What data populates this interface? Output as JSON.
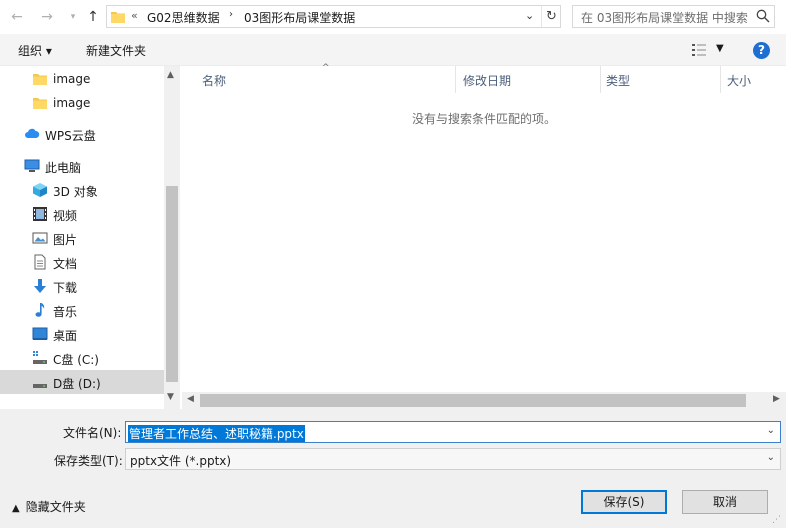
{
  "address": {
    "overflow": "«",
    "crumbs": [
      "G02思维数据",
      "03图形布局课堂数据"
    ],
    "separator": "›"
  },
  "search": {
    "placeholder": "在 03图形布局课堂数据 中搜索"
  },
  "toolbar": {
    "organize": "组织 ▾",
    "new_folder": "新建文件夹",
    "help": "?"
  },
  "nav": {
    "items": [
      {
        "label": "image",
        "icon": "folder-icon"
      },
      {
        "label": "image",
        "icon": "folder-icon"
      },
      {
        "label": "WPS云盘",
        "icon": "cloud-icon"
      },
      {
        "label": "此电脑",
        "icon": "computer-icon"
      },
      {
        "label": "3D 对象",
        "icon": "cube-icon"
      },
      {
        "label": "视频",
        "icon": "video-icon"
      },
      {
        "label": "图片",
        "icon": "picture-icon"
      },
      {
        "label": "文档",
        "icon": "document-icon"
      },
      {
        "label": "下载",
        "icon": "download-icon"
      },
      {
        "label": "音乐",
        "icon": "music-icon"
      },
      {
        "label": "桌面",
        "icon": "desktop-icon"
      },
      {
        "label": "C盘 (C:)",
        "icon": "drive-icon"
      },
      {
        "label": "D盘 (D:)",
        "icon": "drive-icon"
      }
    ],
    "selected_index": 12
  },
  "content": {
    "columns": [
      "名称",
      "修改日期",
      "类型",
      "大小"
    ],
    "empty_message": "没有与搜索条件匹配的项。"
  },
  "form": {
    "filename_label": "文件名(N):",
    "filename_value": "管理者工作总结、述职秘籍.pptx",
    "filetype_label": "保存类型(T):",
    "filetype_value": "pptx文件 (*.pptx)",
    "hide_folders": "隐藏文件夹",
    "save": "保存(S)",
    "cancel": "取消"
  },
  "colors": {
    "accent": "#0078d7",
    "selected_bg": "#d9d9d9",
    "header_text": "#4c607a",
    "help": "#1f6fd1"
  }
}
